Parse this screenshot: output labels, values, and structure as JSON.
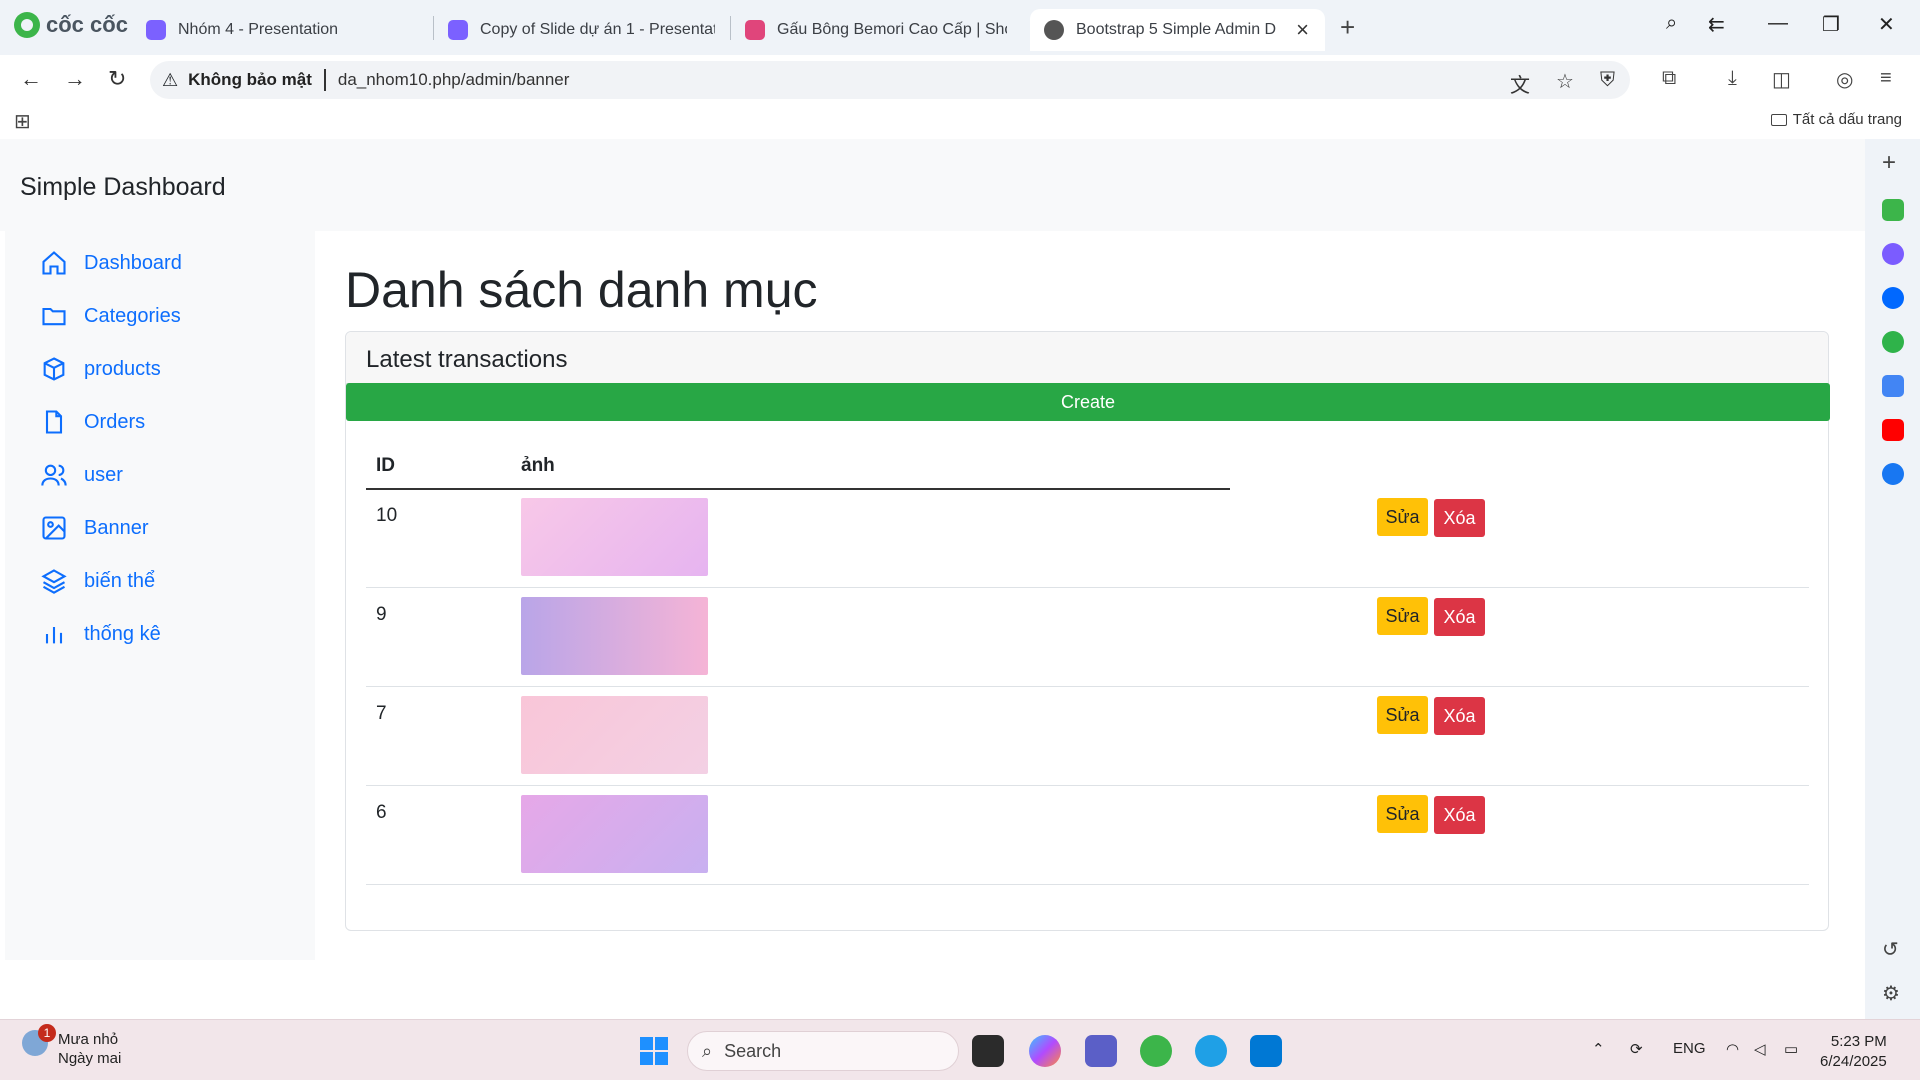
{
  "browser": {
    "brand": "cốc cốc",
    "tabs": [
      {
        "title": "Nhóm 4 - Presentation",
        "color": "#7b61ff"
      },
      {
        "title": "Copy of Slide dự án 1 - Presentati",
        "color": "#7b61ff"
      },
      {
        "title": "Gấu Bông Bemori Cao Cấp | Shop",
        "color": "#e0457b"
      },
      {
        "title": "Bootstrap 5 Simple Admin D",
        "color": "#555555"
      }
    ],
    "security_label": "Không bảo mật",
    "url": "da_nhom10.php/admin/banner",
    "bookmarks_all": "Tất cả dấu trang"
  },
  "nav": {
    "brand": "Simple Dashboard"
  },
  "sidebar": {
    "items": [
      {
        "label": "Dashboard",
        "icon": "home-icon"
      },
      {
        "label": "Categories",
        "icon": "folder-icon"
      },
      {
        "label": "products",
        "icon": "box-icon"
      },
      {
        "label": "Orders",
        "icon": "file-icon"
      },
      {
        "label": "user",
        "icon": "users-icon"
      },
      {
        "label": "Banner",
        "icon": "image-icon"
      },
      {
        "label": "biến thể",
        "icon": "layers-icon"
      },
      {
        "label": "thống kê",
        "icon": "bar-chart-icon"
      }
    ]
  },
  "main": {
    "title": "Danh sách danh mục",
    "card_header": "Latest transactions",
    "create_label": "Create",
    "columns": [
      "ID",
      "ảnh"
    ],
    "rows": [
      {
        "id": "10",
        "edit": "Sửa",
        "delete": "Xóa",
        "thumb_gradient": "linear-gradient(135deg,#f8c8e8,#e6b4f0)"
      },
      {
        "id": "9",
        "edit": "Sửa",
        "delete": "Xóa",
        "thumb_gradient": "linear-gradient(90deg,#b9a5e8,#f5b4d6)"
      },
      {
        "id": "7",
        "edit": "Sửa",
        "delete": "Xóa",
        "thumb_gradient": "linear-gradient(135deg,#f9c6d8,#f3d0e4)"
      },
      {
        "id": "6",
        "edit": "Sửa",
        "delete": "Xóa",
        "thumb_gradient": "linear-gradient(135deg,#e6a8e8,#c8b0f0)"
      }
    ]
  },
  "taskbar": {
    "weather_badge": "1",
    "weather_title": "Mưa nhỏ",
    "weather_sub": "Ngày mai",
    "search_placeholder": "Search",
    "lang": "ENG",
    "time": "5:23 PM",
    "date": "6/24/2025"
  }
}
